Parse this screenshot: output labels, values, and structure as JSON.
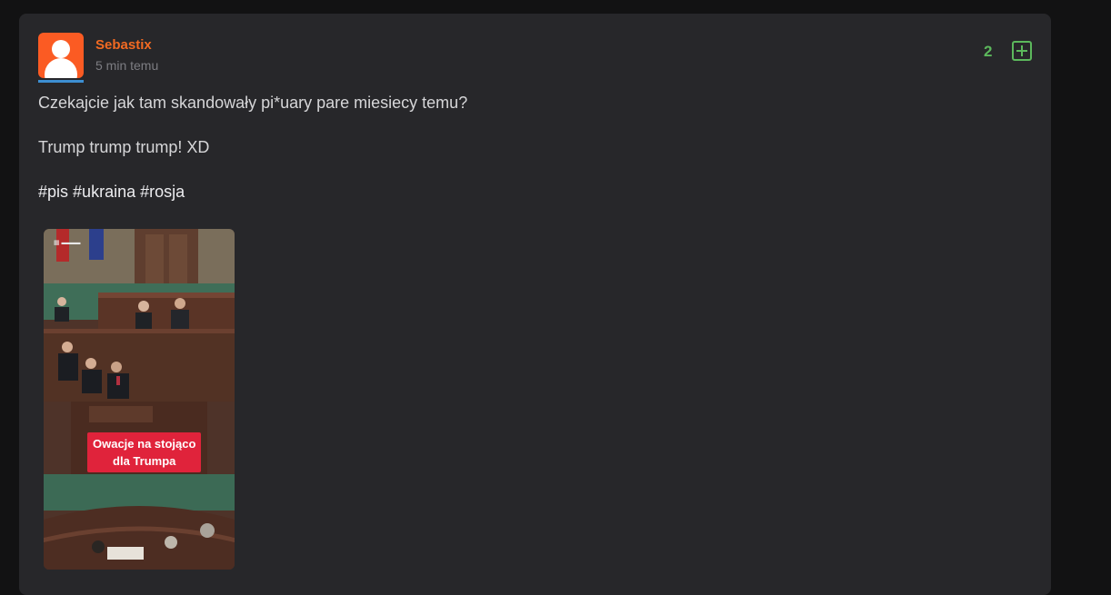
{
  "post": {
    "author": "Sebastix",
    "time": "5 min temu",
    "votes": "2",
    "lines": [
      "Czekajcie jak tam skandowały pi*uary pare miesiecy temu?",
      "Trump trump trump! XD"
    ],
    "tags": [
      "#pis",
      "#ukraina",
      "#rosja"
    ],
    "media": {
      "caption_line1": "Owacje na stojąco",
      "caption_line2": "dla Trumpa"
    }
  },
  "colors": {
    "accent_author": "#f26a22",
    "vote_green": "#5cb85c",
    "avatar_bg": "#fb5b23",
    "caption_red": "#e0233b"
  },
  "icons": {
    "upvote": "plus-square-icon",
    "avatar": "user-avatar-icon"
  }
}
